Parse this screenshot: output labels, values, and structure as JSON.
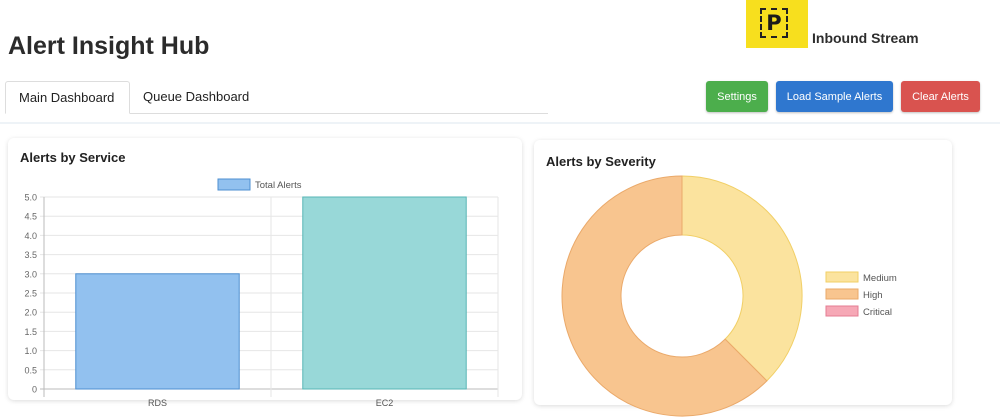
{
  "app": {
    "title": "Alert Insight Hub"
  },
  "brand": {
    "logo_letter": "P",
    "name": "Inbound Stream"
  },
  "tabs": [
    {
      "label": "Main Dashboard",
      "active": true
    },
    {
      "label": "Queue Dashboard",
      "active": false
    }
  ],
  "toolbar": {
    "settings_label": "Settings",
    "load_label": "Load Sample Alerts",
    "clear_label": "Clear Alerts"
  },
  "colors": {
    "settings": "#4cae4c",
    "load": "#2f77cf",
    "clear": "#d9534f"
  },
  "service_card": {
    "title": "Alerts by Service"
  },
  "severity_card": {
    "title": "Alerts by Severity"
  },
  "chart_data": [
    {
      "type": "bar",
      "legend": [
        "Total Alerts"
      ],
      "categories": [
        "RDS",
        "EC2"
      ],
      "series": [
        {
          "name": "Total Alerts",
          "values": [
            3,
            5
          ]
        }
      ],
      "bar_colors": [
        "#92c1ef",
        "#98d8d8"
      ],
      "bar_borders": [
        "#4e8fd0",
        "#57b6b6"
      ],
      "ylim": [
        0,
        5
      ],
      "yticks": [
        "0",
        "0.5",
        "1.0",
        "1.5",
        "2.0",
        "2.5",
        "3.0",
        "3.5",
        "4.0",
        "4.5",
        "5.0"
      ],
      "grid": true,
      "legend_position": "top"
    },
    {
      "type": "pie",
      "variant": "doughnut",
      "labels": [
        "Medium",
        "High",
        "Critical"
      ],
      "values": [
        3,
        5,
        0
      ],
      "colors": [
        "#fbe39e",
        "#f8c58f",
        "#f6a8b6"
      ],
      "border_colors": [
        "#f1cf66",
        "#eaa96a",
        "#e47d93"
      ],
      "legend_position": "right"
    }
  ]
}
